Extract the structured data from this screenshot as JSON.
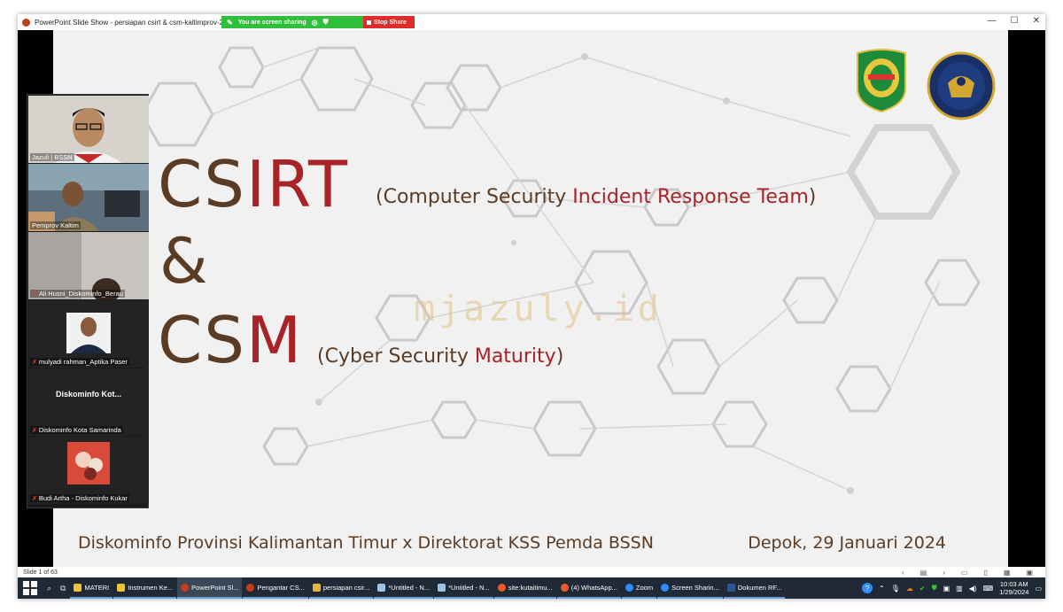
{
  "window": {
    "title": "PowerPoint Slide Show  -  persiapan csirt & csm-kaltimprov-2024",
    "share_text": "You are screen sharing",
    "stop_share": "Stop Share",
    "controls": [
      "—",
      "☐",
      "✕"
    ]
  },
  "slide": {
    "title1_part_a": "CS",
    "title1_part_b": "IRT",
    "sub1_open": "(Computer Security ",
    "sub1_red": "Incident Response Team",
    "sub1_close": ")",
    "amp": "&",
    "title2_part_a": "CS",
    "title2_part_b": "M",
    "sub2_open": "(Cyber Security ",
    "sub2_red": "Maturity",
    "sub2_close": ")",
    "watermark": "mjazuly.id",
    "footer_left": "Diskominfo Provinsi Kalimantan Timur x Direktorat KSS Pemda BSSN",
    "footer_right": "Depok, 29 Januari 2024",
    "colors": {
      "brown": "#5a3c25",
      "red": "#a82226"
    }
  },
  "participants": [
    {
      "name": "Jazuli | BSSN",
      "muted": false
    },
    {
      "name": "Pemprov Kaltim",
      "muted": false
    },
    {
      "name": "Ali Husni_Diskominfo_Berau",
      "muted": true
    },
    {
      "name": "mulyadi rahman_Aptika Paser",
      "muted": true
    },
    {
      "name": "Diskominfo Kota Samarinda",
      "muted": true,
      "center_label": "Diskominfo  Kot..."
    },
    {
      "name": "Budi Artha - Diskominfo Kukar",
      "muted": true
    }
  ],
  "status": {
    "slide_counter": "Slide 1 of 63"
  },
  "taskbar": {
    "search_icon": "search-icon",
    "items": [
      {
        "label": "MATERI",
        "color": "#f2c23a"
      },
      {
        "label": "Instrumen Ke...",
        "color": "#f2c23a"
      },
      {
        "label": "PowerPoint Sl...",
        "color": "#c43e1c"
      },
      {
        "label": "Pengantar CS...",
        "color": "#c43e1c"
      },
      {
        "label": "persiapan csir...",
        "color": "#e8b53a"
      },
      {
        "label": "*Untitled - N...",
        "color": "#9fc3e6"
      },
      {
        "label": "*Untitled - N...",
        "color": "#9fc3e6"
      },
      {
        "label": "site:kutaitimu...",
        "color": "#f05a28"
      },
      {
        "label": "(4) WhatsApp...",
        "color": "#f05a28"
      },
      {
        "label": "Zoom",
        "color": "#2d8cff"
      },
      {
        "label": "Screen Sharin...",
        "color": "#2d8cff"
      },
      {
        "label": "Dokumen RF...",
        "color": "#2b579a"
      }
    ],
    "clock_time": "10:03 AM",
    "clock_date": "1/29/2024"
  }
}
